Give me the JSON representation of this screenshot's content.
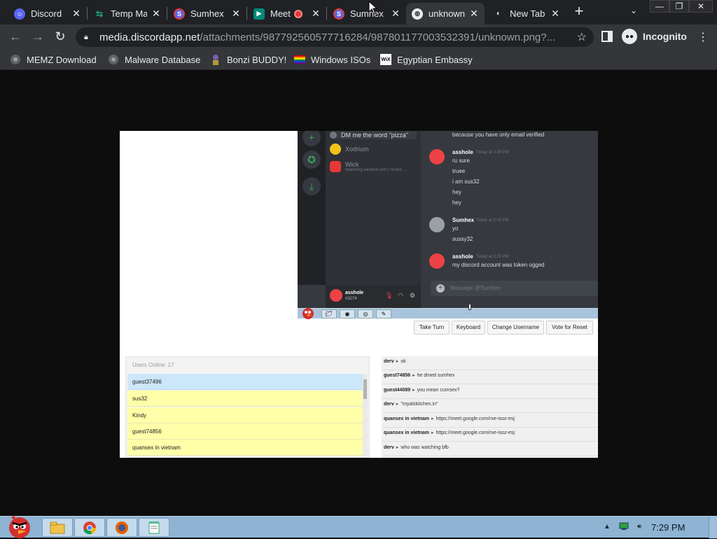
{
  "browser": {
    "tabs": [
      {
        "title": "Discord",
        "icon": "discord-icon",
        "color": "#5865f2"
      },
      {
        "title": "Temp Ma",
        "icon": "temp-mail-icon",
        "color": "#1fa37a"
      },
      {
        "title": "Sumhex",
        "icon": "sumhex-icon",
        "color": "#e53935"
      },
      {
        "title": "Meet",
        "icon": "google-meet-icon",
        "color": "#00897b"
      },
      {
        "title": "Sumhex",
        "icon": "sumhex-icon",
        "color": "#e53935"
      },
      {
        "title": "unknown",
        "icon": "globe-icon",
        "color": "#e8eaed"
      },
      {
        "title": "New Tab",
        "icon": "incognito-icon",
        "color": "#e8eaed"
      }
    ],
    "url_host": "media.discordapp.net",
    "url_path": "/attachments/987792560577716284/987801177003532391/unknown.png?...",
    "incognito_label": "Incognito"
  },
  "bookmarks": [
    {
      "label": "MEMZ Download",
      "icon": "globe-icon"
    },
    {
      "label": "Malware Database",
      "icon": "globe-icon"
    },
    {
      "label": "Bonzi BUDDY!",
      "icon": "bonzi-icon"
    },
    {
      "label": "Windows ISOs",
      "icon": "rainbow-flag-icon"
    },
    {
      "label": "Egyptian Embassy",
      "icon": "wix-icon"
    }
  ],
  "discord": {
    "dm_items": [
      {
        "name": "DM me the word \"pizza\"",
        "status": ""
      },
      {
        "name": "Xodrium",
        "status": ""
      },
      {
        "name": "Wick",
        "status": "Watching wickbot.com | Shard..."
      }
    ],
    "user_panel": {
      "name": "asshole",
      "tag": "#3274"
    },
    "messages": [
      {
        "type": "line",
        "text": "because you have only email verified"
      },
      {
        "type": "header",
        "author": "asshole",
        "time": "Today at 3:28 PM"
      },
      {
        "type": "line",
        "text": "ru sure"
      },
      {
        "type": "line",
        "text": "truee"
      },
      {
        "type": "line",
        "text": "i am sus32"
      },
      {
        "type": "line",
        "text": "hey"
      },
      {
        "type": "line",
        "text": "hey"
      },
      {
        "type": "header",
        "author": "Sumhex",
        "time": "Today at 3:29 PM"
      },
      {
        "type": "line",
        "text": "yo"
      },
      {
        "type": "line",
        "text": "sussy32"
      },
      {
        "type": "header",
        "author": "asshole",
        "time": "Today at 3:29 PM"
      },
      {
        "type": "line",
        "text": "my discord account was token ogged"
      }
    ],
    "input_placeholder": "Message @Sumhex"
  },
  "buttons": {
    "take_turn": "Take Turn",
    "keyboard": "Keyboard",
    "change_username": "Change Username",
    "vote_reset": "Vote for Reset"
  },
  "users": {
    "count_label": "Users Online: 17",
    "list": [
      "guest37496",
      "sus32",
      "Kindy",
      "guest74856",
      "quansex in vietnam"
    ]
  },
  "chat": [
    {
      "who": "derv",
      "text": "ok"
    },
    {
      "who": "guest74856",
      "text": "he dmed sumhex"
    },
    {
      "who": "guest44089",
      "text": "you mean cumsex?"
    },
    {
      "who": "derv",
      "text": "\"royalskitchen.in\""
    },
    {
      "who": "quansex in vietnam",
      "text": "https://meet.google.com/rxe-isoz-esj"
    },
    {
      "who": "quansex in vietnam",
      "text": "https://meet.google.com/rxe-isoz-esj"
    },
    {
      "who": "derv",
      "text": "who was watching bfb"
    }
  ],
  "taskbar": {
    "clock": "7:29 PM",
    "apps": [
      "explorer-icon",
      "chrome-icon",
      "firefox-icon",
      "notepad-icon"
    ]
  }
}
